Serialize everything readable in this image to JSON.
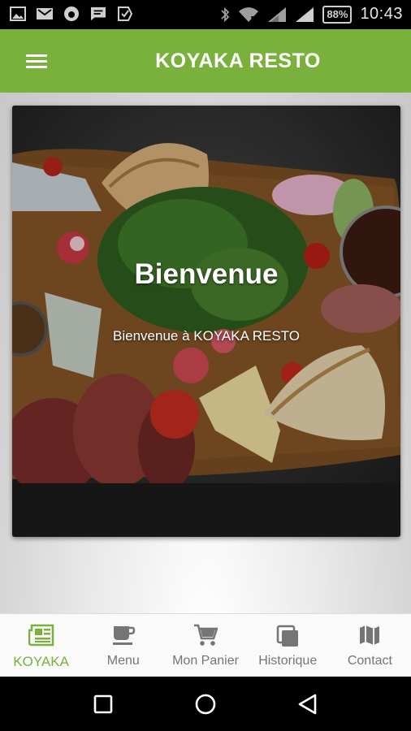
{
  "status_bar": {
    "time": "10:43",
    "battery": "88%",
    "left_icons": [
      "image-icon",
      "gmail-icon",
      "firefox-icon",
      "message-icon",
      "download-check-icon"
    ],
    "right_icons": [
      "bluetooth-icon",
      "wifi-icon",
      "signal-icon",
      "signal-icon"
    ]
  },
  "app_bar": {
    "title": "KOYAKA RESTO",
    "menu_icon": "hamburger-menu-icon",
    "color": "#7ab03c"
  },
  "hero": {
    "title": "Bienvenue",
    "subtitle": "Bienvenue à KOYAKA RESTO"
  },
  "bottom_nav": {
    "active_color": "#7ab03c",
    "inactive_color": "#757575",
    "items": [
      {
        "label": "KOYAKA",
        "icon": "newspaper-icon",
        "active": true
      },
      {
        "label": "Menu",
        "icon": "coffee-cup-icon",
        "active": false
      },
      {
        "label": "Mon Panier",
        "icon": "cart-icon",
        "active": false
      },
      {
        "label": "Historique",
        "icon": "history-stack-icon",
        "active": false
      },
      {
        "label": "Contact",
        "icon": "map-icon",
        "active": false
      }
    ]
  },
  "system_nav": {
    "buttons": [
      "recents-square-icon",
      "home-circle-icon",
      "back-triangle-icon"
    ]
  }
}
